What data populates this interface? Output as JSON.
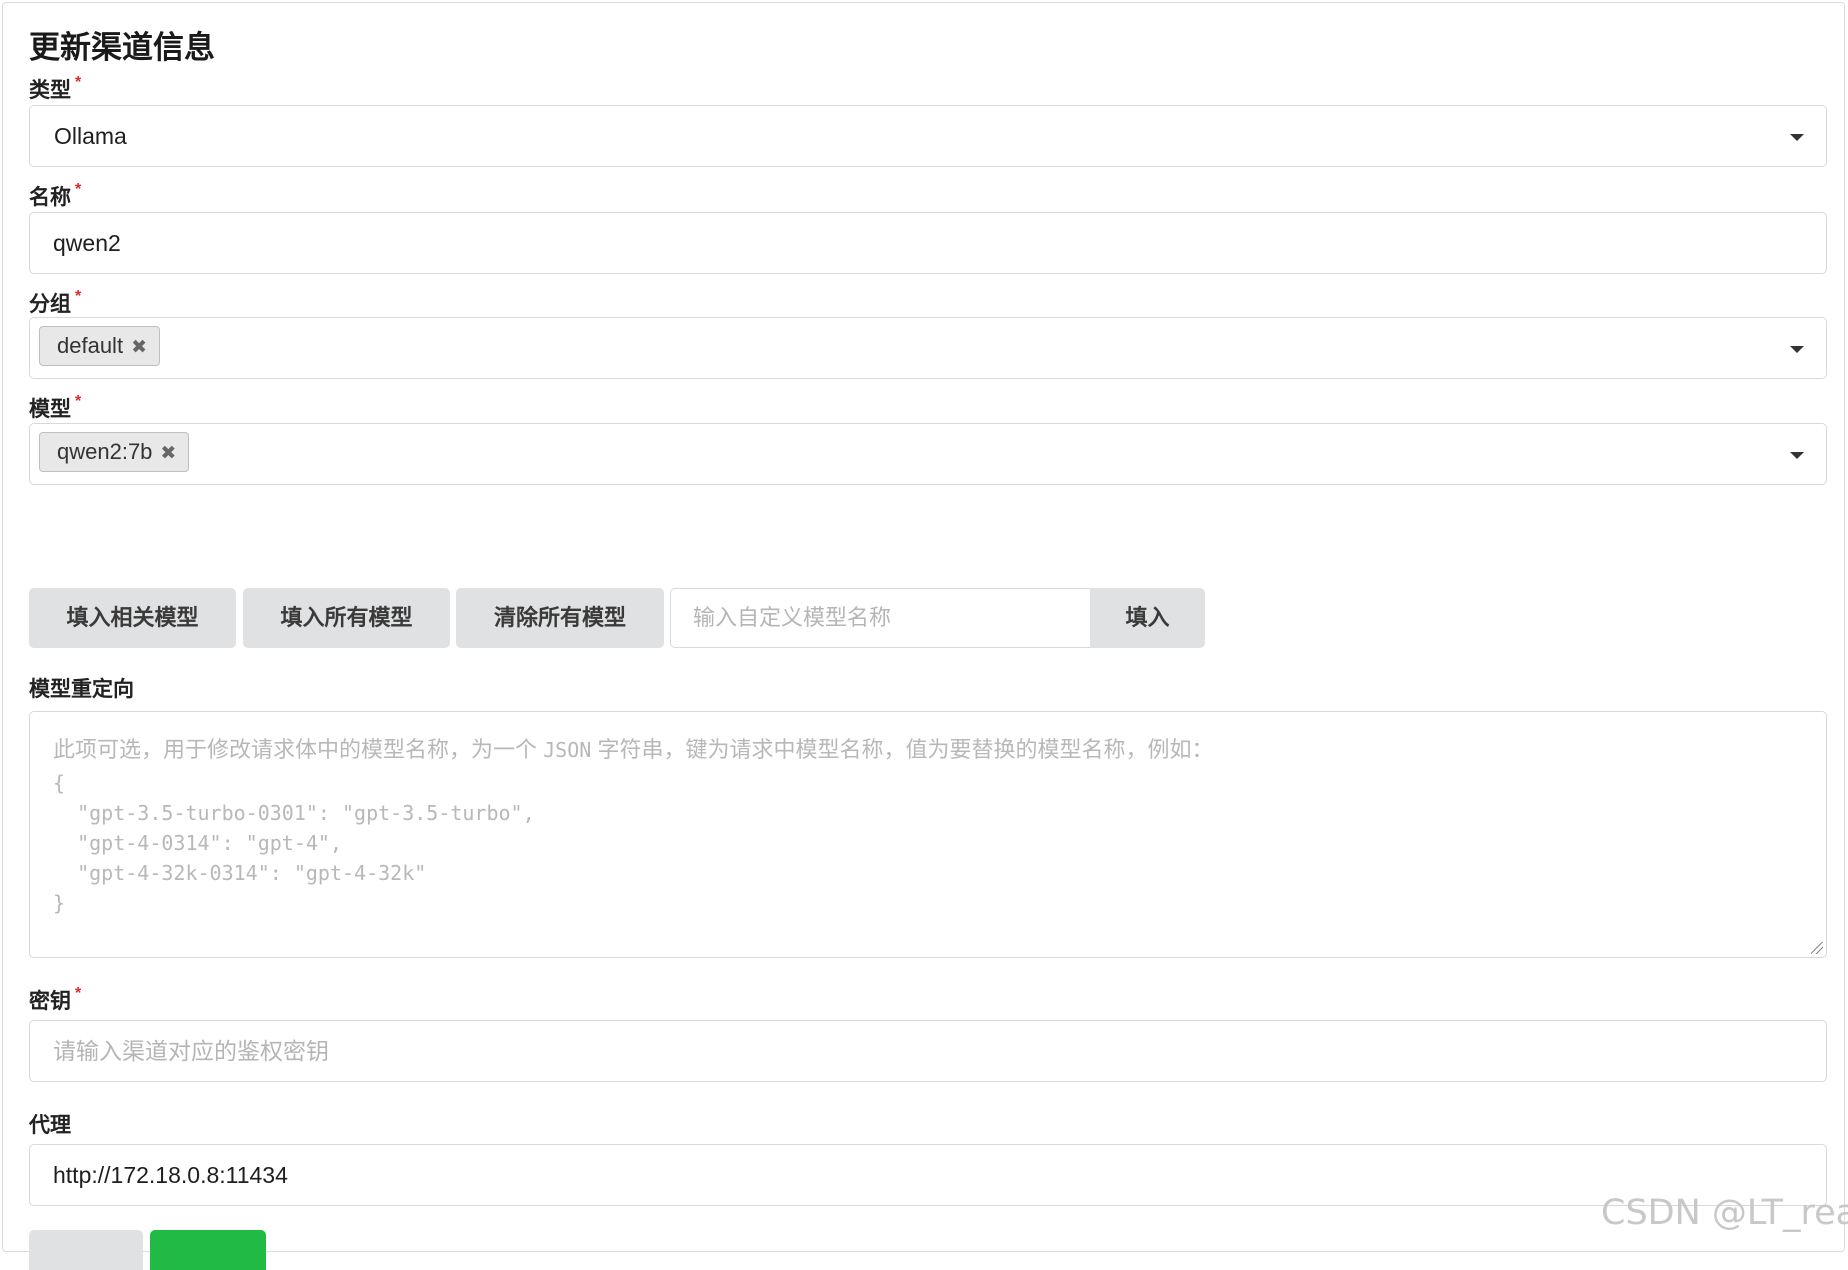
{
  "page_title": "更新渠道信息",
  "fields": {
    "type": {
      "label": "类型",
      "required_mark": "*",
      "value": "Ollama"
    },
    "name": {
      "label": "名称",
      "required_mark": "*",
      "value": "qwen2"
    },
    "group": {
      "label": "分组",
      "required_mark": "*",
      "tags": [
        "default"
      ],
      "tag_remove_glyph": "✖"
    },
    "models": {
      "label": "模型",
      "required_mark": "*",
      "tags": [
        "qwen2:7b"
      ],
      "tag_remove_glyph": "✖"
    },
    "model_mapping": {
      "label": "模型重定向",
      "placeholder_text": "此项可选，用于修改请求体中的模型名称，为一个",
      "placeholder_json_word": "JSON",
      "placeholder_tail": "字符串，键为请求中模型名称，值为要替换的模型名称，例如：",
      "placeholder_code": "{\n  \"gpt-3.5-turbo-0301\": \"gpt-3.5-turbo\",\n  \"gpt-4-0314\": \"gpt-4\",\n  \"gpt-4-32k-0314\": \"gpt-4-32k\"\n}"
    },
    "key": {
      "label": "密钥",
      "required_mark": "*",
      "placeholder": "请输入渠道对应的鉴权密钥",
      "value": ""
    },
    "proxy": {
      "label": "代理",
      "value": "http://172.18.0.8:11434"
    }
  },
  "model_actions": {
    "fill_related": "填入相关模型",
    "fill_all": "填入所有模型",
    "clear_all": "清除所有模型",
    "custom_placeholder": "输入自定义模型名称",
    "custom_fill": "填入"
  },
  "watermark": "CSDN @LT_real",
  "colors": {
    "submit_button": "#21ba45",
    "cancel_button": "#e0e1e2",
    "required_star": "#db2828"
  }
}
